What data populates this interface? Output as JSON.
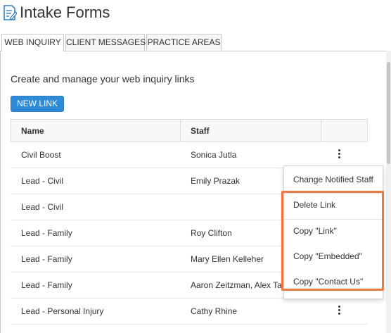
{
  "header": {
    "title": "Intake Forms",
    "icon": "form-edit-icon"
  },
  "tabs": [
    {
      "label": "WEB INQUIRY",
      "active": true
    },
    {
      "label": "CLIENT MESSAGES",
      "active": false
    },
    {
      "label": "PRACTICE AREAS",
      "active": false
    }
  ],
  "main": {
    "description": "Create and manage your web inquiry links",
    "new_link_label": "NEW LINK"
  },
  "table": {
    "columns": [
      "Name",
      "Staff"
    ],
    "rows": [
      {
        "name": "Civil Boost",
        "staff": "Sonica Jutla"
      },
      {
        "name": "Lead - Civil",
        "staff": "Emily Prazak"
      },
      {
        "name": "Lead - Civil",
        "staff": ""
      },
      {
        "name": "Lead - Family",
        "staff": "Roy Clifton"
      },
      {
        "name": "Lead - Family",
        "staff": "Mary Ellen Kelleher"
      },
      {
        "name": "Lead - Family",
        "staff": "Aaron Zeitzman, Alex Taylor"
      },
      {
        "name": "Lead - Personal Injury",
        "staff": "Cathy Rhine"
      }
    ]
  },
  "menu": {
    "items": [
      "Change Notified Staff",
      "Delete Link",
      "Copy \"Link\"",
      "Copy \"Embedded\"",
      "Copy \"Contact Us\""
    ]
  },
  "colors": {
    "accent": "#2f8bd6",
    "highlight": "#e8793f"
  }
}
